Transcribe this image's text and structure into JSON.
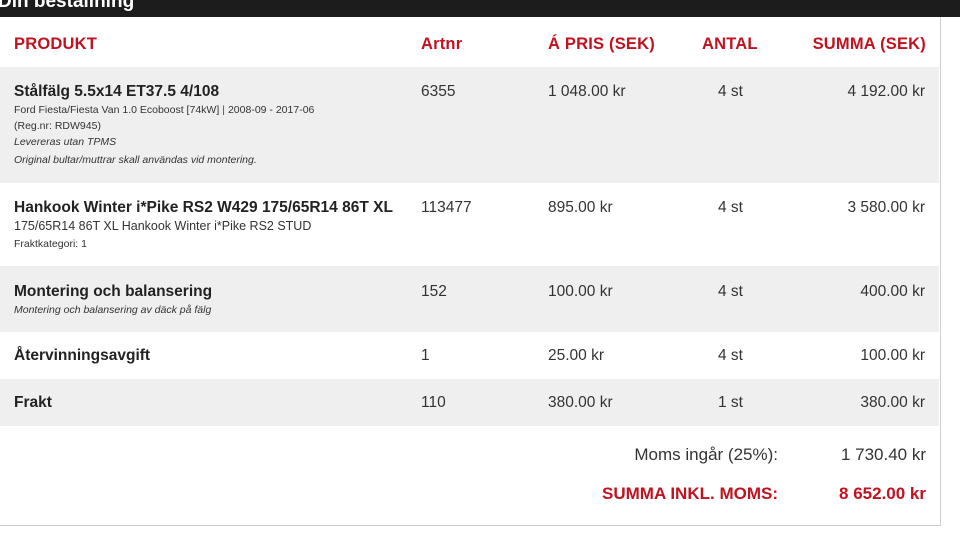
{
  "header": {
    "title": "Din beställning"
  },
  "table": {
    "columns": {
      "product": "PRODUKT",
      "artnr": "Artnr",
      "unit_price": "Á PRIS (SEK)",
      "quantity": "ANTAL",
      "sum": "SUMMA (SEK)"
    },
    "rows": [
      {
        "name": "Stålfälg 5.5x14 ET37.5 4/108",
        "vehicle": "Ford Fiesta/Fiesta Van 1.0 Ecoboost [74kW]",
        "years": "2008-09 - 2017-06",
        "regnr": "(Reg.nr: RDW945)",
        "note1": "Levereras utan TPMS",
        "note2": "Original bultar/muttrar skall användas vid montering.",
        "artnr": "6355",
        "unit_price": "1 048.00 kr",
        "quantity": "4 st",
        "sum": "4 192.00 kr"
      },
      {
        "name": "Hankook Winter i*Pike RS2 W429 175/65R14 86T XL",
        "description": "175/65R14 86T XL Hankook Winter i*Pike RS2 STUD",
        "freight_category": "Fraktkategori: 1",
        "artnr": "113477",
        "unit_price": "895.00 kr",
        "quantity": "4 st",
        "sum": "3 580.00 kr"
      },
      {
        "name": "Montering och balansering",
        "note": "Montering och balansering av däck på fälg",
        "artnr": "152",
        "unit_price": "100.00 kr",
        "quantity": "4 st",
        "sum": "400.00 kr"
      },
      {
        "name": "Återvinningsavgift",
        "artnr": "1",
        "unit_price": "25.00 kr",
        "quantity": "4 st",
        "sum": "100.00 kr"
      },
      {
        "name": "Frakt",
        "artnr": "110",
        "unit_price": "380.00 kr",
        "quantity": "1 st",
        "sum": "380.00 kr"
      }
    ]
  },
  "totals": {
    "vat_label": "Moms ingår (25%):",
    "vat_value": "1 730.40 kr",
    "total_label": "SUMMA INKL. MOMS:",
    "total_value": "8 652.00 kr"
  },
  "colors": {
    "accent": "#c1121f",
    "header_bg": "#1c1c1c",
    "row_shade": "#efefef"
  }
}
